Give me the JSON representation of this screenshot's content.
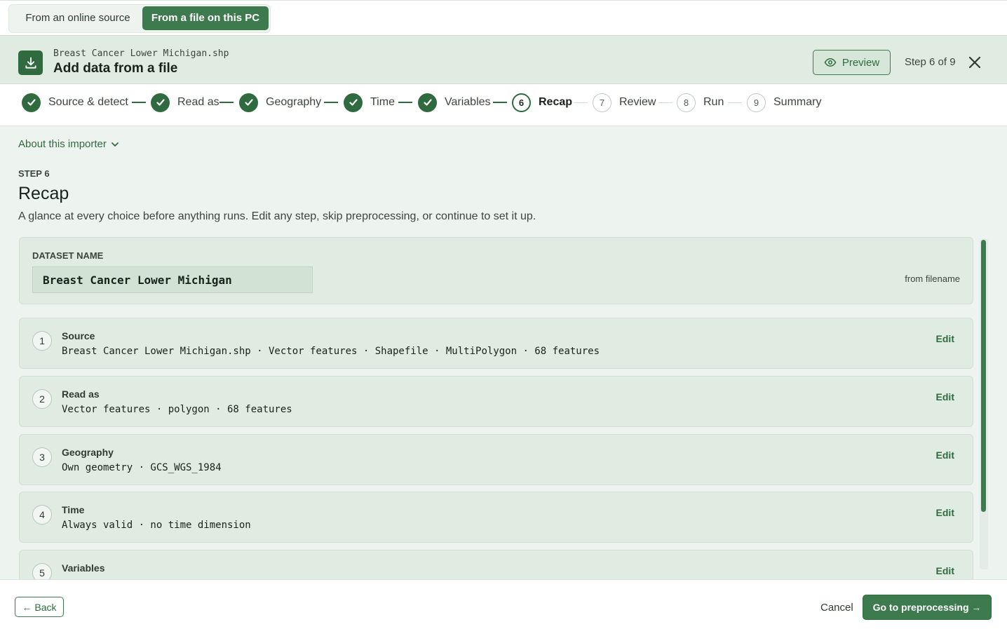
{
  "top_tabs": {
    "online": "From an online source",
    "file": "From a file on this PC"
  },
  "header": {
    "filename": "Breast Cancer Lower Michigan.shp",
    "title": "Add data from a file",
    "preview_label": "Preview",
    "step_counter": "Step 6 of 9"
  },
  "stepper": {
    "steps": [
      {
        "label": "Source & detect",
        "state": "done"
      },
      {
        "label": "Read as",
        "state": "done"
      },
      {
        "label": "Geography",
        "state": "done"
      },
      {
        "label": "Time",
        "state": "done"
      },
      {
        "label": "Variables",
        "state": "done"
      },
      {
        "label": "Recap",
        "number": "6",
        "state": "current"
      },
      {
        "label": "Review",
        "number": "7",
        "state": "todo"
      },
      {
        "label": "Run",
        "number": "8",
        "state": "todo"
      },
      {
        "label": "Summary",
        "number": "9",
        "state": "todo"
      }
    ]
  },
  "main": {
    "about_link": "About this importer",
    "step_kicker": "STEP 6",
    "title": "Recap",
    "description": "A glance at every choice before anything runs. Edit any step, skip preprocessing, or continue to set it up.",
    "dataset": {
      "label": "DATASET NAME",
      "value": "Breast Cancer Lower Michigan",
      "hint": "from filename"
    },
    "recap_rows": [
      {
        "number": "1",
        "title": "Source",
        "detail": "Breast Cancer Lower Michigan.shp · Vector features · Shapefile · MultiPolygon · 68 features",
        "edit": "Edit"
      },
      {
        "number": "2",
        "title": "Read as",
        "detail": "Vector features · polygon · 68 features",
        "edit": "Edit"
      },
      {
        "number": "3",
        "title": "Geography",
        "detail": "Own geometry · GCS_WGS_1984",
        "edit": "Edit"
      },
      {
        "number": "4",
        "title": "Time",
        "detail": "Always valid · no time dimension",
        "edit": "Edit"
      },
      {
        "number": "5",
        "title": "Variables",
        "detail": "",
        "edit": "Edit"
      }
    ]
  },
  "footer": {
    "back_label": "← Back",
    "cancel_label": "Cancel",
    "next_label": "Go to preprocessing →"
  },
  "colors": {
    "accent": "#3d7a4d",
    "accent_dark": "#2f6b3f",
    "header_bg": "#e0ebe2",
    "main_bg": "#edf4ef"
  }
}
